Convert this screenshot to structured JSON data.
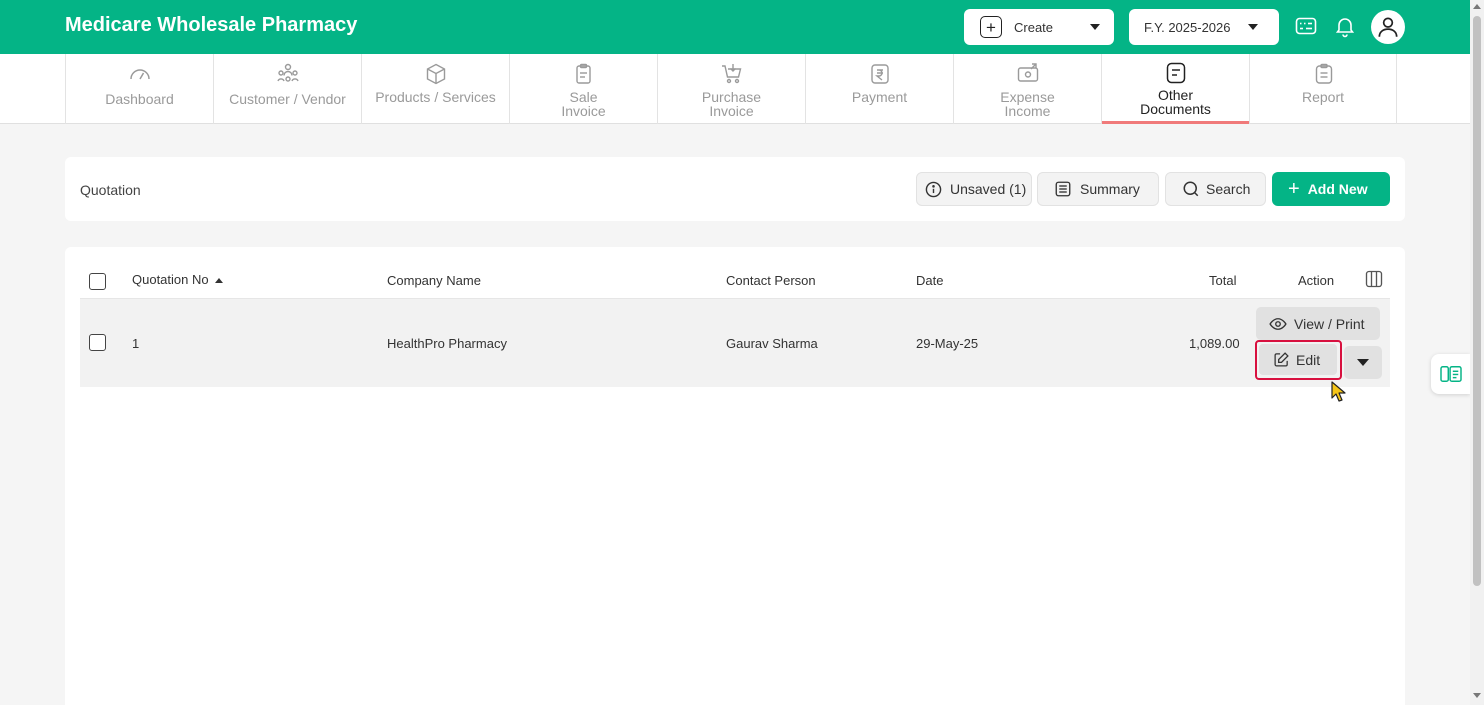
{
  "header": {
    "app_title": "Medicare Wholesale Pharmacy",
    "create_label": "Create",
    "fy_label": "F.Y. 2025-2026",
    "brand_color": "#04b486",
    "icons": [
      "keyboard-icon",
      "bell-icon",
      "user-icon"
    ]
  },
  "nav": {
    "tabs": [
      {
        "line1": "Dashboard",
        "line2": "",
        "icon": "gauge-icon"
      },
      {
        "line1": "Customer / Vendor",
        "line2": "",
        "icon": "people-icon"
      },
      {
        "line1": "Products / Services",
        "line2": "",
        "icon": "box-icon"
      },
      {
        "line1": "Sale",
        "line2": "Invoice",
        "icon": "clipboard-icon"
      },
      {
        "line1": "Purchase",
        "line2": "Invoice",
        "icon": "cart-icon"
      },
      {
        "line1": "Payment",
        "line2": "",
        "icon": "rupee-icon"
      },
      {
        "line1": "Expense",
        "line2": "Income",
        "icon": "cash-icon"
      },
      {
        "line1": "Other",
        "line2": "Documents",
        "icon": "document-icon"
      },
      {
        "line1": "Report",
        "line2": "",
        "icon": "report-icon"
      }
    ],
    "active_tab": "Other Documents"
  },
  "toolbar": {
    "page_title": "Quotation",
    "unsaved_label": "Unsaved (1)",
    "summary_label": "Summary",
    "search_label": "Search",
    "add_new_label": "Add New"
  },
  "table": {
    "columns": {
      "quotation_no": "Quotation No",
      "company_name": "Company Name",
      "contact_person": "Contact Person",
      "date": "Date",
      "total": "Total",
      "action": "Action"
    },
    "rows": [
      {
        "quotation_no": "1",
        "company_name": "HealthPro Pharmacy",
        "contact_person": "Gaurav Sharma",
        "date": "29-May-25",
        "total": "1,089.00",
        "view_label": "View / Print",
        "edit_label": "Edit"
      }
    ]
  }
}
